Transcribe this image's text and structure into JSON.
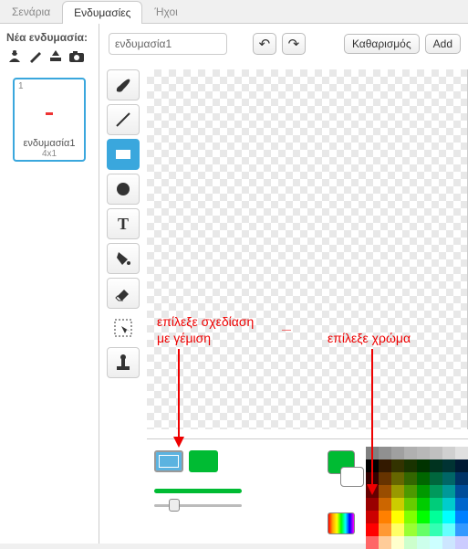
{
  "tabs": {
    "scripts": "Σενάρια",
    "costumes": "Ενδυμασίες",
    "sounds": "Ήχοι"
  },
  "left": {
    "new_label": "Νέα ενδυμασία:",
    "thumb": {
      "index": "1",
      "name": "ενδυμασία1",
      "dims": "4x1"
    }
  },
  "editor": {
    "name_value": "ενδυμασία1",
    "clear": "Καθαρισμός",
    "add": "Add"
  },
  "annotations": {
    "fill1": "επίλεξε σχεδίαση",
    "fill2": "με γέμιση",
    "color": "επίλεξε χρώμα"
  },
  "palette": [
    [
      "#808080",
      "#909090",
      "#a0a0a0",
      "#b0b0b0",
      "#b8b8b8",
      "#c0c0c0",
      "#d0d0d0",
      "#e0e0e0",
      "#f0f0f0",
      "#ffffff"
    ],
    [
      "#000000",
      "#331900",
      "#333300",
      "#193300",
      "#003300",
      "#00331f",
      "#003333",
      "#001a33",
      "#000033",
      "#330033"
    ],
    [
      "#330000",
      "#663300",
      "#666600",
      "#336600",
      "#006600",
      "#00663d",
      "#006666",
      "#003366",
      "#000066",
      "#660066"
    ],
    [
      "#660000",
      "#994d00",
      "#999900",
      "#4d9900",
      "#009900",
      "#00995c",
      "#009999",
      "#004d99",
      "#000099",
      "#990099"
    ],
    [
      "#990000",
      "#cc6600",
      "#cccc00",
      "#66cc00",
      "#00cc00",
      "#00cc7a",
      "#00cccc",
      "#0066cc",
      "#0000cc",
      "#cc00cc"
    ],
    [
      "#cc0000",
      "#ff8000",
      "#ffff00",
      "#80ff00",
      "#00ff00",
      "#00ff99",
      "#00ffff",
      "#0080ff",
      "#0000ff",
      "#ff00ff"
    ],
    [
      "#ff0000",
      "#ff9933",
      "#ffff66",
      "#99ff33",
      "#66ff66",
      "#33ffb3",
      "#66ffff",
      "#3399ff",
      "#6666ff",
      "#ff66ff"
    ],
    [
      "#ff6666",
      "#ffcc99",
      "#ffffcc",
      "#ccffcc",
      "#ccffeb",
      "#ccffff",
      "#cce6ff",
      "#ccccff",
      "#e6ccff",
      "#ffccff"
    ]
  ]
}
